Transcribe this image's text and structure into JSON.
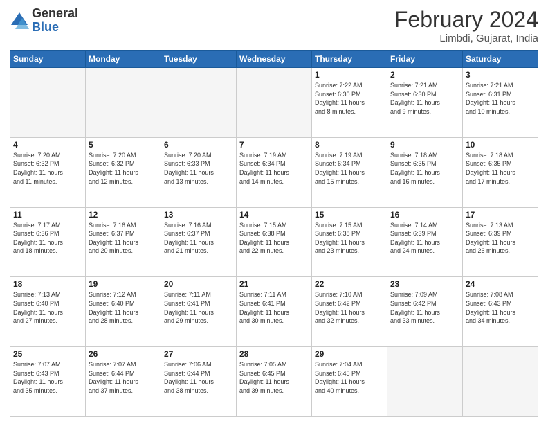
{
  "header": {
    "logo_general": "General",
    "logo_blue": "Blue",
    "month_year": "February 2024",
    "location": "Limbdi, Gujarat, India"
  },
  "weekdays": [
    "Sunday",
    "Monday",
    "Tuesday",
    "Wednesday",
    "Thursday",
    "Friday",
    "Saturday"
  ],
  "weeks": [
    [
      {
        "day": "",
        "info": ""
      },
      {
        "day": "",
        "info": ""
      },
      {
        "day": "",
        "info": ""
      },
      {
        "day": "",
        "info": ""
      },
      {
        "day": "1",
        "info": "Sunrise: 7:22 AM\nSunset: 6:30 PM\nDaylight: 11 hours\nand 8 minutes."
      },
      {
        "day": "2",
        "info": "Sunrise: 7:21 AM\nSunset: 6:30 PM\nDaylight: 11 hours\nand 9 minutes."
      },
      {
        "day": "3",
        "info": "Sunrise: 7:21 AM\nSunset: 6:31 PM\nDaylight: 11 hours\nand 10 minutes."
      }
    ],
    [
      {
        "day": "4",
        "info": "Sunrise: 7:20 AM\nSunset: 6:32 PM\nDaylight: 11 hours\nand 11 minutes."
      },
      {
        "day": "5",
        "info": "Sunrise: 7:20 AM\nSunset: 6:32 PM\nDaylight: 11 hours\nand 12 minutes."
      },
      {
        "day": "6",
        "info": "Sunrise: 7:20 AM\nSunset: 6:33 PM\nDaylight: 11 hours\nand 13 minutes."
      },
      {
        "day": "7",
        "info": "Sunrise: 7:19 AM\nSunset: 6:34 PM\nDaylight: 11 hours\nand 14 minutes."
      },
      {
        "day": "8",
        "info": "Sunrise: 7:19 AM\nSunset: 6:34 PM\nDaylight: 11 hours\nand 15 minutes."
      },
      {
        "day": "9",
        "info": "Sunrise: 7:18 AM\nSunset: 6:35 PM\nDaylight: 11 hours\nand 16 minutes."
      },
      {
        "day": "10",
        "info": "Sunrise: 7:18 AM\nSunset: 6:35 PM\nDaylight: 11 hours\nand 17 minutes."
      }
    ],
    [
      {
        "day": "11",
        "info": "Sunrise: 7:17 AM\nSunset: 6:36 PM\nDaylight: 11 hours\nand 18 minutes."
      },
      {
        "day": "12",
        "info": "Sunrise: 7:16 AM\nSunset: 6:37 PM\nDaylight: 11 hours\nand 20 minutes."
      },
      {
        "day": "13",
        "info": "Sunrise: 7:16 AM\nSunset: 6:37 PM\nDaylight: 11 hours\nand 21 minutes."
      },
      {
        "day": "14",
        "info": "Sunrise: 7:15 AM\nSunset: 6:38 PM\nDaylight: 11 hours\nand 22 minutes."
      },
      {
        "day": "15",
        "info": "Sunrise: 7:15 AM\nSunset: 6:38 PM\nDaylight: 11 hours\nand 23 minutes."
      },
      {
        "day": "16",
        "info": "Sunrise: 7:14 AM\nSunset: 6:39 PM\nDaylight: 11 hours\nand 24 minutes."
      },
      {
        "day": "17",
        "info": "Sunrise: 7:13 AM\nSunset: 6:39 PM\nDaylight: 11 hours\nand 26 minutes."
      }
    ],
    [
      {
        "day": "18",
        "info": "Sunrise: 7:13 AM\nSunset: 6:40 PM\nDaylight: 11 hours\nand 27 minutes."
      },
      {
        "day": "19",
        "info": "Sunrise: 7:12 AM\nSunset: 6:40 PM\nDaylight: 11 hours\nand 28 minutes."
      },
      {
        "day": "20",
        "info": "Sunrise: 7:11 AM\nSunset: 6:41 PM\nDaylight: 11 hours\nand 29 minutes."
      },
      {
        "day": "21",
        "info": "Sunrise: 7:11 AM\nSunset: 6:41 PM\nDaylight: 11 hours\nand 30 minutes."
      },
      {
        "day": "22",
        "info": "Sunrise: 7:10 AM\nSunset: 6:42 PM\nDaylight: 11 hours\nand 32 minutes."
      },
      {
        "day": "23",
        "info": "Sunrise: 7:09 AM\nSunset: 6:42 PM\nDaylight: 11 hours\nand 33 minutes."
      },
      {
        "day": "24",
        "info": "Sunrise: 7:08 AM\nSunset: 6:43 PM\nDaylight: 11 hours\nand 34 minutes."
      }
    ],
    [
      {
        "day": "25",
        "info": "Sunrise: 7:07 AM\nSunset: 6:43 PM\nDaylight: 11 hours\nand 35 minutes."
      },
      {
        "day": "26",
        "info": "Sunrise: 7:07 AM\nSunset: 6:44 PM\nDaylight: 11 hours\nand 37 minutes."
      },
      {
        "day": "27",
        "info": "Sunrise: 7:06 AM\nSunset: 6:44 PM\nDaylight: 11 hours\nand 38 minutes."
      },
      {
        "day": "28",
        "info": "Sunrise: 7:05 AM\nSunset: 6:45 PM\nDaylight: 11 hours\nand 39 minutes."
      },
      {
        "day": "29",
        "info": "Sunrise: 7:04 AM\nSunset: 6:45 PM\nDaylight: 11 hours\nand 40 minutes."
      },
      {
        "day": "",
        "info": ""
      },
      {
        "day": "",
        "info": ""
      }
    ]
  ]
}
